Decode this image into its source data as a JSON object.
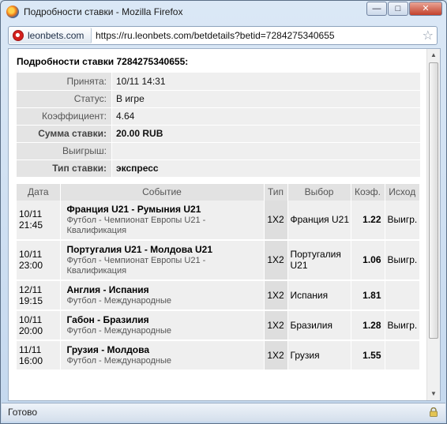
{
  "window": {
    "title": "Подробности ставки - Mozilla Firefox",
    "minimize_label": "—",
    "maximize_label": "□",
    "close_label": "✕"
  },
  "addressbar": {
    "site": "leonbets.com",
    "url": "https://ru.leonbets.com/betdetails?betid=7284275340655"
  },
  "page": {
    "heading": "Подробности ставки 7284275340655:",
    "info": [
      {
        "label": "Принята:",
        "value": "10/11 14:31"
      },
      {
        "label": "Статус:",
        "value": "В игре"
      },
      {
        "label": "Коэффициент:",
        "value": "4.64"
      },
      {
        "label": "Сумма ставки:",
        "value": "20.00 RUB"
      },
      {
        "label": "Выигрыш:",
        "value": ""
      },
      {
        "label": "Тип ставки:",
        "value": "экспресс"
      }
    ],
    "columns": [
      "Дата",
      "Событие",
      "Тип",
      "Выбор",
      "Коэф.",
      "Исход"
    ],
    "rows": [
      {
        "date": "10/11",
        "time": "21:45",
        "event": "Франция U21 - Румыния U21",
        "league": "Футбол - Чемпионат Европы U21 - Квалификация",
        "type": "1X2",
        "selection": "Франция U21",
        "coef": "1.22",
        "result": "Выигр."
      },
      {
        "date": "10/11",
        "time": "23:00",
        "event": "Португалия U21 - Молдова U21",
        "league": "Футбол - Чемпионат Европы U21 - Квалификация",
        "type": "1X2",
        "selection": "Португалия U21",
        "coef": "1.06",
        "result": "Выигр."
      },
      {
        "date": "12/11",
        "time": "19:15",
        "event": "Англия - Испания",
        "league": "Футбол - Международные",
        "type": "1X2",
        "selection": "Испания",
        "coef": "1.81",
        "result": ""
      },
      {
        "date": "10/11",
        "time": "20:00",
        "event": "Габон - Бразилия",
        "league": "Футбол - Международные",
        "type": "1X2",
        "selection": "Бразилия",
        "coef": "1.28",
        "result": "Выигр."
      },
      {
        "date": "11/11",
        "time": "16:00",
        "event": "Грузия - Молдова",
        "league": "Футбол - Международные",
        "type": "1X2",
        "selection": "Грузия",
        "coef": "1.55",
        "result": ""
      }
    ]
  },
  "statusbar": {
    "text": "Готово"
  },
  "icons": {
    "app": "firefox-icon",
    "site": "leonbets-icon",
    "bookmark": "star-icon",
    "security": "lock-icon"
  },
  "colors": {
    "label_bg": "#e4e4e4",
    "value_bg": "#efefef",
    "header_bg": "#e2e2e2"
  }
}
